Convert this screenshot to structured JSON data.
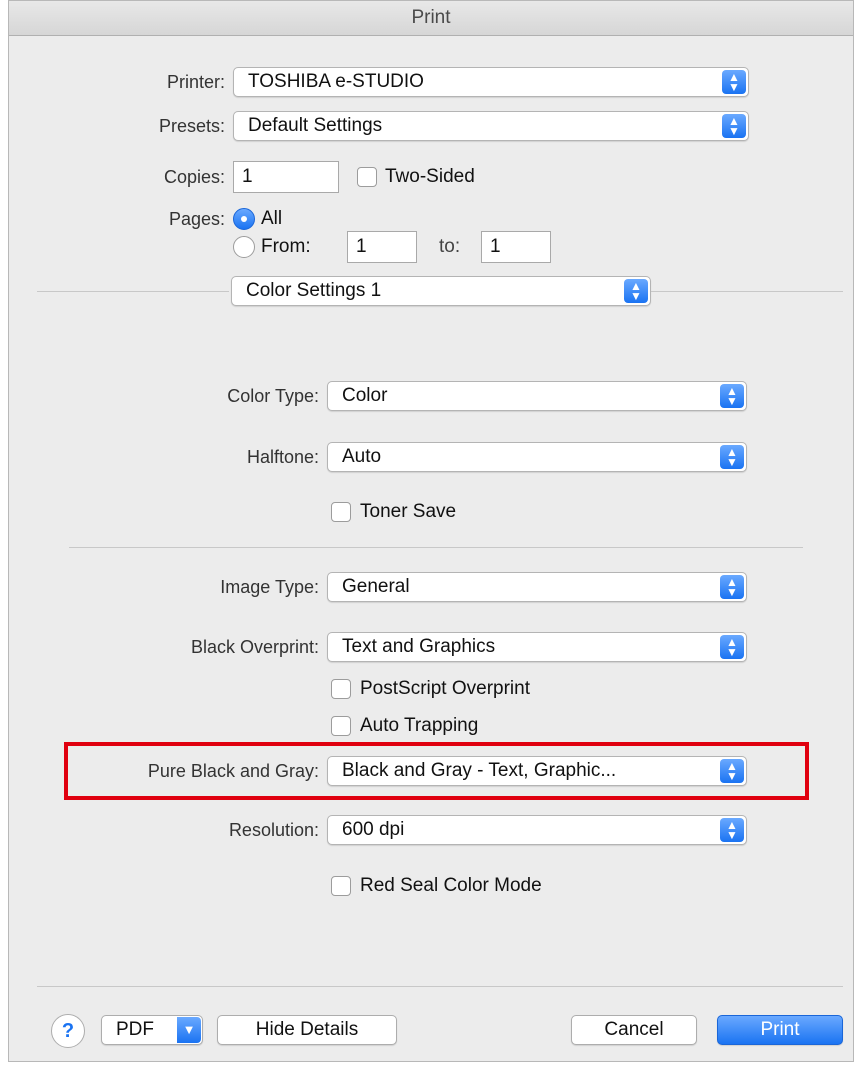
{
  "window": {
    "title": "Print"
  },
  "printer": {
    "label": "Printer:",
    "value": "TOSHIBA e-STUDIO"
  },
  "presets": {
    "label": "Presets:",
    "value": "Default Settings"
  },
  "copies": {
    "label": "Copies:",
    "value": "1",
    "two_sided_label": "Two-Sided",
    "two_sided_checked": false
  },
  "pages": {
    "label": "Pages:",
    "all_label": "All",
    "from_label": "From:",
    "to_label": "to:",
    "from_value": "1",
    "to_value": "1",
    "selected": "All"
  },
  "section": {
    "value": "Color Settings 1"
  },
  "color_type": {
    "label": "Color Type:",
    "value": "Color"
  },
  "halftone": {
    "label": "Halftone:",
    "value": "Auto"
  },
  "toner_save": {
    "label": "Toner Save",
    "checked": false
  },
  "image_type": {
    "label": "Image Type:",
    "value": "General"
  },
  "black_overprint": {
    "label": "Black Overprint:",
    "value": "Text and Graphics"
  },
  "postscript_overprint": {
    "label": "PostScript Overprint",
    "checked": false
  },
  "auto_trapping": {
    "label": "Auto Trapping",
    "checked": false
  },
  "pure_black_gray": {
    "label": "Pure Black and Gray:",
    "value": "Black and Gray - Text, Graphic..."
  },
  "resolution": {
    "label": "Resolution:",
    "value": "600 dpi"
  },
  "red_seal": {
    "label": "Red Seal Color Mode",
    "checked": false
  },
  "footer": {
    "help": "?",
    "pdf": "PDF",
    "hide_details": "Hide Details",
    "cancel": "Cancel",
    "print": "Print"
  },
  "colors": {
    "accent": "#1a73f2",
    "highlight": "#e0000f"
  },
  "icons": {
    "popup_arrows": "up-down-chevron-icon",
    "pdf_menu": "chevron-down-icon",
    "help": "question-mark-icon"
  }
}
